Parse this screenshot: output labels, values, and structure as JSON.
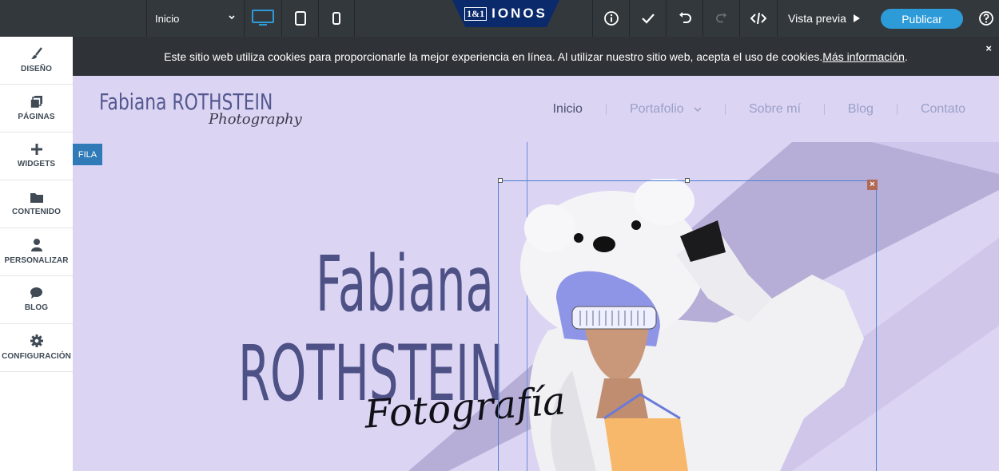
{
  "toolbar": {
    "page_select": "Inicio",
    "brand_box": "1&1",
    "brand_word": "IONOS",
    "preview_label": "Vista previa",
    "publish_label": "Publicar",
    "icons": [
      "chevron-down-icon",
      "desktop-icon",
      "tablet-icon",
      "mobile-icon",
      "info-icon",
      "check-icon",
      "undo-icon",
      "redo-icon",
      "code-icon",
      "play-icon",
      "help-icon"
    ]
  },
  "sidebar": {
    "items": [
      {
        "label": "DISEÑO",
        "icon": "brush-icon"
      },
      {
        "label": "PÁGINAS",
        "icon": "pages-icon"
      },
      {
        "label": "WIDGETS",
        "icon": "plus-icon"
      },
      {
        "label": "CONTENIDO",
        "icon": "folder-icon"
      },
      {
        "label": "PERSONALIZAR",
        "icon": "user-icon"
      },
      {
        "label": "BLOG",
        "icon": "chat-bubble-icon"
      },
      {
        "label": "CONFIGURACIÓN",
        "icon": "gear-icon"
      }
    ]
  },
  "cookie": {
    "text": "Este sitio web utiliza cookies para proporcionarle la mejor experiencia en línea. Al utilizar nuestro sitio web, acepta el uso de cookies. ",
    "link": "Más información",
    "close": "×"
  },
  "site": {
    "logo_main": "Fabiana ROTHSTEIN",
    "logo_sub": "Photography",
    "nav": [
      "Inicio",
      "Portafolio",
      "Sobre mí",
      "Blog",
      "Contato"
    ],
    "active_nav": "Inicio"
  },
  "hero": {
    "row_tag": "FILA",
    "line1": "Fabiana",
    "line2": "ROTHSTEIN",
    "subtitle": "Fotografía",
    "close": "×"
  },
  "colors": {
    "toolbar": "#33383d",
    "accent": "#2e9bd9",
    "hero_bg": "#dcd4f3",
    "hero_text": "#4d5185"
  }
}
